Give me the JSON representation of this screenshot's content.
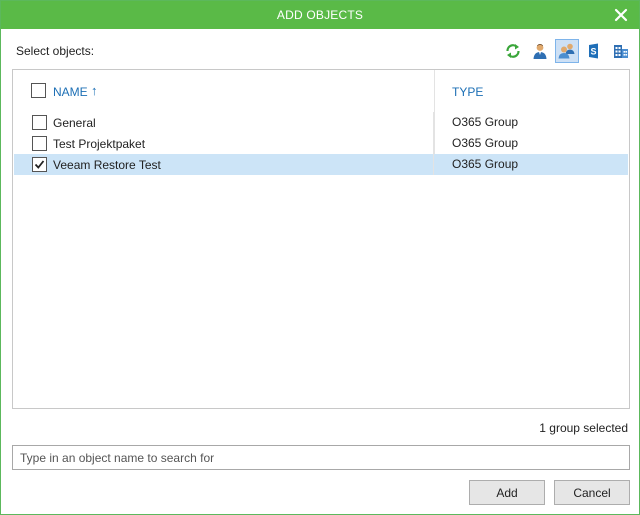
{
  "window": {
    "title": "ADD OBJECTS"
  },
  "select_label": "Select objects:",
  "toolbar": {
    "icons": [
      "refresh-icon",
      "user-icon",
      "group-icon",
      "sharepoint-icon",
      "organization-icon"
    ],
    "active": "group-icon"
  },
  "grid": {
    "columns": {
      "name": "NAME",
      "type": "TYPE",
      "sort": "↑"
    },
    "rows": [
      {
        "name": "General",
        "type": "O365 Group",
        "checked": false
      },
      {
        "name": "Test Projektpaket",
        "type": "O365 Group",
        "checked": false
      },
      {
        "name": "Veeam Restore Test",
        "type": "O365 Group",
        "checked": true
      }
    ]
  },
  "status": "1 group selected",
  "search": {
    "placeholder": "Type in an object name to search for",
    "value": ""
  },
  "buttons": {
    "add": "Add",
    "cancel": "Cancel"
  },
  "colors": {
    "title_bar": "#5aba47",
    "accent": "#1c6fb5",
    "selection": "#cce4f7"
  }
}
